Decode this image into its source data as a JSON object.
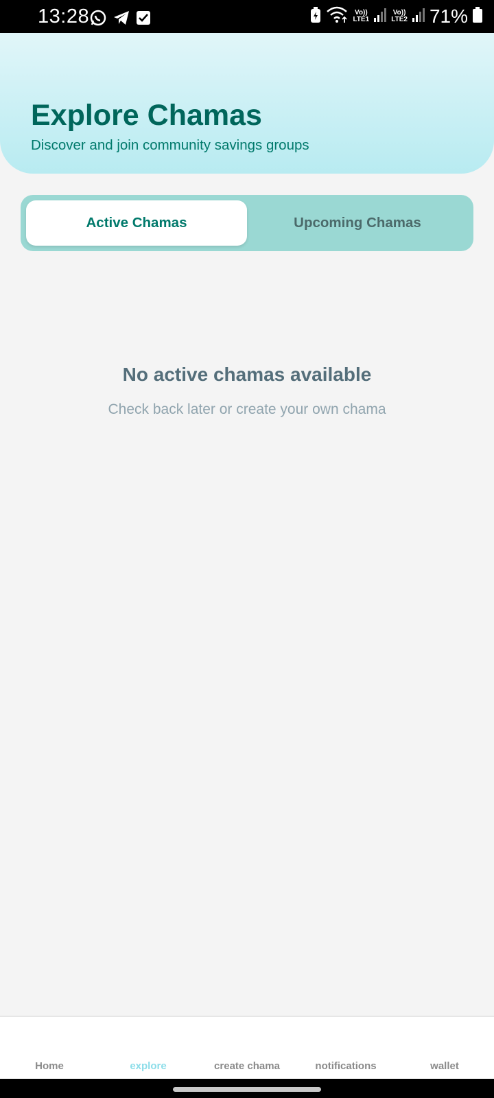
{
  "status_bar": {
    "time": "13:28",
    "battery": "71%",
    "net1": "Vo))\nLTE1",
    "net2": "Vo))\nLTE2",
    "left_icons": [
      "whatsapp-icon",
      "telegram-icon",
      "checkbox-icon"
    ],
    "right_icons": [
      "battery-saver-icon",
      "wifi-icon",
      "signal-icon",
      "signal-icon",
      "battery-icon"
    ]
  },
  "header": {
    "title": "Explore Chamas",
    "subtitle": "Discover and join community savings groups"
  },
  "tabs": [
    {
      "label": "Active Chamas",
      "active": true
    },
    {
      "label": "Upcoming Chamas",
      "active": false
    }
  ],
  "empty_state": {
    "title": "No active chamas available",
    "subtitle": "Check back later or create your own chama"
  },
  "bottom_nav": {
    "items": [
      {
        "label": "Home",
        "active": false
      },
      {
        "label": "explore",
        "active": true
      },
      {
        "label": "create chama",
        "active": false
      },
      {
        "label": "notifications",
        "active": false
      },
      {
        "label": "wallet",
        "active": false
      }
    ]
  },
  "colors": {
    "primary": "#00796b",
    "header_gradient_top": "#e1f6f9",
    "header_gradient_bottom": "#b8ebf1",
    "tab_track": "#9ad8d3",
    "nav_active": "#8cdde9",
    "background": "#f4f4f4"
  }
}
